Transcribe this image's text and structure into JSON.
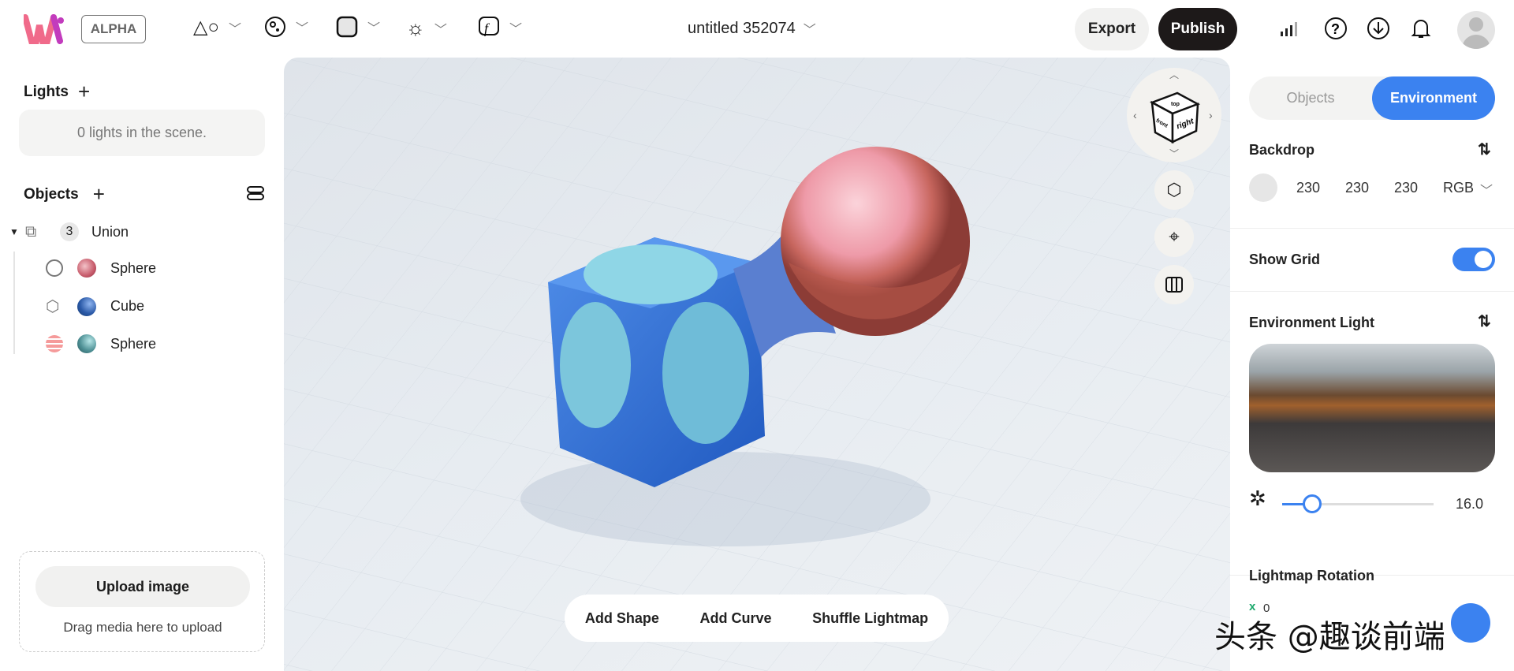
{
  "header": {
    "badge": "ALPHA",
    "title": "untitled 352074",
    "export": "Export",
    "publish": "Publish"
  },
  "left": {
    "lights_title": "Lights",
    "lights_empty": "0 lights in the scene.",
    "objects_title": "Objects",
    "tree": {
      "count": "3",
      "name": "Union",
      "children": [
        {
          "name": "Sphere",
          "color": "#c75b6b"
        },
        {
          "name": "Cube",
          "color": "#2b5aa8"
        },
        {
          "name": "Sphere",
          "color": "#4f9196"
        }
      ]
    },
    "upload_button": "Upload image",
    "upload_hint": "Drag media here to upload"
  },
  "viewport": {
    "cube_faces": {
      "top": "top",
      "front": "front",
      "right": "right"
    },
    "bottom": {
      "add_shape": "Add Shape",
      "add_curve": "Add Curve",
      "shuffle": "Shuffle Lightmap"
    }
  },
  "right": {
    "tabs": {
      "objects": "Objects",
      "environment": "Environment"
    },
    "backdrop": {
      "label": "Backdrop",
      "r": "230",
      "g": "230",
      "b": "230",
      "mode": "RGB"
    },
    "show_grid": {
      "label": "Show Grid",
      "on": true
    },
    "env_light": {
      "label": "Environment Light",
      "intensity": "16.0",
      "slider_fraction": 0.2
    },
    "lightmap_rotation": {
      "label": "Lightmap Rotation",
      "x_label": "x",
      "x_value": "0"
    }
  },
  "watermark": "头条 @趣谈前端"
}
